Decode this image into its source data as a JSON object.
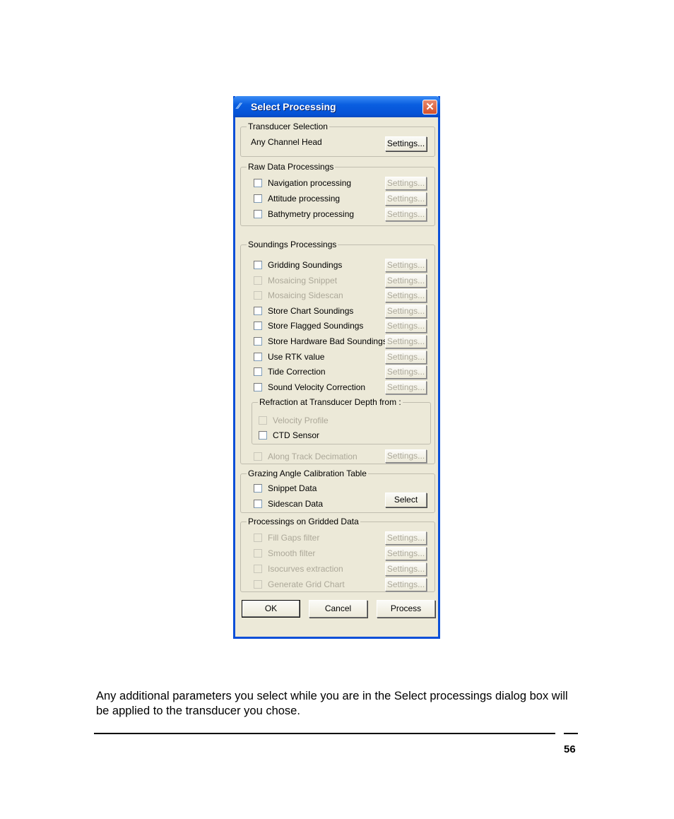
{
  "dialog": {
    "title": "Select Processing",
    "app_icon": "app-logo-icon",
    "close_glyph": "✕",
    "transducer": {
      "legend": "Transducer Selection",
      "value": "Any Channel Head",
      "settings_label": "Settings..."
    },
    "raw": {
      "legend": "Raw Data Processings",
      "items": [
        {
          "label": "Navigation processing",
          "enabled": true,
          "checked": false,
          "settings_label": "Settings...",
          "settings_enabled": false
        },
        {
          "label": "Attitude processing",
          "enabled": true,
          "checked": false,
          "settings_label": "Settings...",
          "settings_enabled": false
        },
        {
          "label": "Bathymetry processing",
          "enabled": true,
          "checked": false,
          "settings_label": "Settings...",
          "settings_enabled": false
        }
      ]
    },
    "soundings": {
      "legend": "Soundings Processings",
      "items": [
        {
          "label": "Gridding Soundings",
          "enabled": true,
          "checked": false,
          "settings_label": "Settings..."
        },
        {
          "label": "Mosaicing Snippet",
          "enabled": false,
          "checked": false,
          "settings_label": "Settings..."
        },
        {
          "label": "Mosaicing Sidescan",
          "enabled": false,
          "checked": false,
          "settings_label": "Settings..."
        },
        {
          "label": "Store Chart Soundings",
          "enabled": true,
          "checked": false,
          "settings_label": "Settings..."
        },
        {
          "label": "Store Flagged Soundings",
          "enabled": true,
          "checked": false,
          "settings_label": "Settings..."
        },
        {
          "label": "Store Hardware Bad Soundings",
          "enabled": true,
          "checked": false,
          "settings_label": "Settings..."
        },
        {
          "label": "Use RTK value",
          "enabled": true,
          "checked": false,
          "settings_label": "Settings..."
        },
        {
          "label": "Tide Correction",
          "enabled": true,
          "checked": false,
          "settings_label": "Settings..."
        },
        {
          "label": "Sound Velocity Correction",
          "enabled": true,
          "checked": false,
          "settings_label": "Settings..."
        }
      ],
      "refraction": {
        "legend": "Refraction at Transducer Depth from :",
        "items": [
          {
            "label": "Velocity Profile",
            "enabled": false,
            "checked": false
          },
          {
            "label": "CTD Sensor",
            "enabled": true,
            "checked": false
          }
        ]
      },
      "decimation": {
        "label": "Along Track Decimation",
        "enabled": false,
        "checked": false,
        "settings_label": "Settings..."
      }
    },
    "grazing": {
      "legend": "Grazing Angle Calibration Table",
      "items": [
        {
          "label": "Snippet Data",
          "enabled": true,
          "checked": false
        },
        {
          "label": "Sidescan Data",
          "enabled": true,
          "checked": false
        }
      ],
      "select_label": "Select"
    },
    "gridded": {
      "legend": "Processings on Gridded Data",
      "items": [
        {
          "label": "Fill Gaps filter",
          "enabled": false,
          "checked": false,
          "settings_label": "Settings..."
        },
        {
          "label": "Smooth filter",
          "enabled": false,
          "checked": false,
          "settings_label": "Settings..."
        },
        {
          "label": "Isocurves extraction",
          "enabled": false,
          "checked": false,
          "settings_label": "Settings..."
        },
        {
          "label": "Generate Grid Chart",
          "enabled": false,
          "checked": false,
          "settings_label": "Settings..."
        }
      ]
    },
    "buttons": {
      "ok": "OK",
      "cancel": "Cancel",
      "process": "Process"
    }
  },
  "document": {
    "paragraph": "Any additional parameters you select while you are in the Select processings dialog box will be applied to the transducer you chose.",
    "page_number": "56"
  }
}
